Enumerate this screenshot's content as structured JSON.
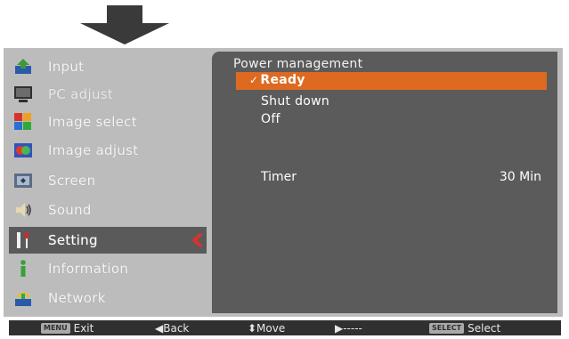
{
  "left_menu": [
    {
      "label": "Input",
      "icon": "input-icon"
    },
    {
      "label": "PC adjust",
      "icon": "monitor-icon"
    },
    {
      "label": "Image select",
      "icon": "image-select-icon"
    },
    {
      "label": "Image adjust",
      "icon": "image-adjust-icon"
    },
    {
      "label": "Screen",
      "icon": "screen-icon"
    },
    {
      "label": "Sound",
      "icon": "speaker-icon"
    },
    {
      "label": "Setting",
      "icon": "setting-icon"
    },
    {
      "label": "Information",
      "icon": "info-icon"
    },
    {
      "label": "Network",
      "icon": "network-icon"
    }
  ],
  "active_index": 6,
  "panel": {
    "title": "Power management",
    "options": [
      {
        "label": "Ready",
        "selected": true,
        "check": "✓"
      },
      {
        "label": "Shut down",
        "selected": false
      },
      {
        "label": "Off",
        "selected": false
      }
    ],
    "timer_label": "Timer",
    "timer_value": "30 Min"
  },
  "statusbar": {
    "exit_key": "MENU",
    "exit_label": "Exit",
    "back_label": "◀Back",
    "move_label": "⬍Move",
    "right_label": "▶-----",
    "select_key": "SELECT",
    "select_label": "Select"
  },
  "colors": {
    "accent": "#dd6a20",
    "panel": "#5b5b5b",
    "frame": "#bcbcbc",
    "statusbar": "#303030"
  }
}
